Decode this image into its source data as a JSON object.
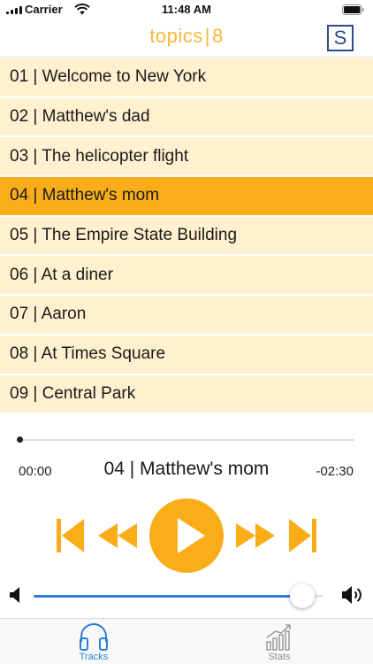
{
  "status_bar": {
    "carrier": "Carrier",
    "time": "11:48 AM"
  },
  "header": {
    "logo_word": "topics",
    "logo_sep": "|",
    "logo_num": "8",
    "right_button": "S"
  },
  "tracks": [
    {
      "label": "01 | Welcome to New York",
      "active": false
    },
    {
      "label": "02 | Matthew's dad",
      "active": false
    },
    {
      "label": "03 | The helicopter flight",
      "active": false
    },
    {
      "label": "04 | Matthew's mom",
      "active": true
    },
    {
      "label": "05 | The Empire State Building",
      "active": false
    },
    {
      "label": "06 | At a diner",
      "active": false
    },
    {
      "label": "07 | Aaron",
      "active": false
    },
    {
      "label": "08 | At Times Square",
      "active": false
    },
    {
      "label": "09 | Central Park",
      "active": false
    }
  ],
  "player": {
    "elapsed": "00:00",
    "remaining": "-02:30",
    "now_playing": "04 | Matthew's mom",
    "progress": 0.0,
    "volume": 0.93
  },
  "tabs": {
    "tracks": "Tracks",
    "stats": "Stats",
    "selected": "tracks"
  },
  "colors": {
    "accent": "#faad19",
    "row_bg": "#fff0cf",
    "tint": "#2b7fd7",
    "logo_border": "#2c4b8a"
  },
  "icons": {
    "status": [
      "signal-icon",
      "wifi-icon",
      "battery-icon"
    ],
    "controls": [
      "skip-back-icon",
      "rewind-icon",
      "play-icon",
      "fast-forward-icon",
      "skip-forward-icon"
    ],
    "volume": [
      "volume-low-icon",
      "volume-high-icon"
    ],
    "tabs": [
      "headphones-icon",
      "bar-chart-icon"
    ]
  }
}
